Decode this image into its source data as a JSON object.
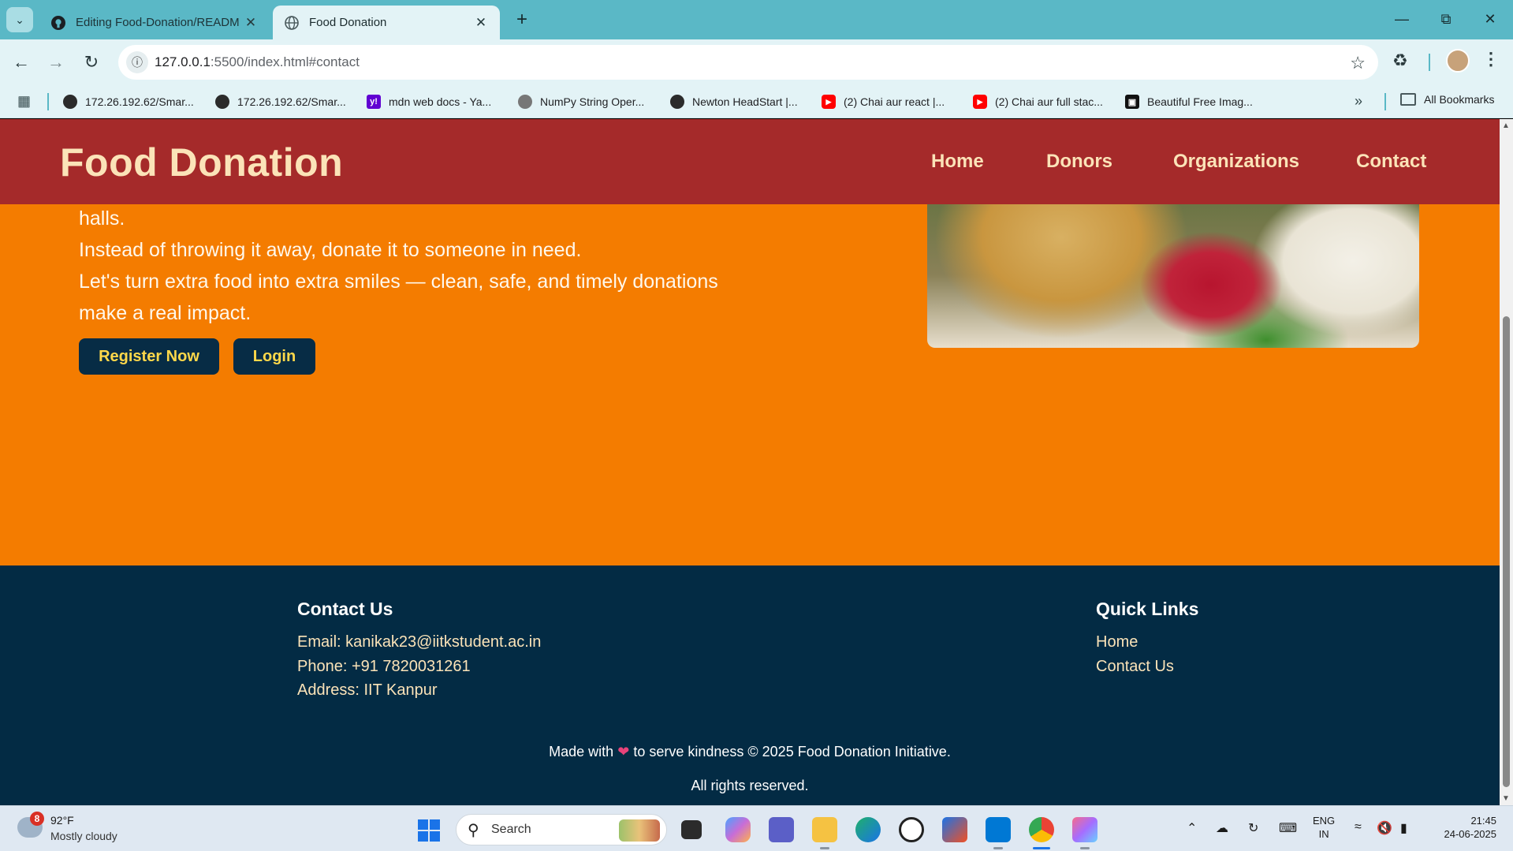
{
  "browser": {
    "tabs": [
      {
        "title": "Editing Food-Donation/READM",
        "icon": "github-icon",
        "active": false
      },
      {
        "title": "Food Donation",
        "icon": "globe-icon",
        "active": true
      }
    ],
    "new_tab_label": "+",
    "url_host": "127.0.0.1",
    "url_path": ":5500/index.html#contact",
    "bookmarks": [
      {
        "label": "172.26.192.62/Smar...",
        "icon": "globe-icon"
      },
      {
        "label": "172.26.192.62/Smar...",
        "icon": "globe-icon"
      },
      {
        "label": "mdn web docs - Ya...",
        "icon": "yahoo-icon"
      },
      {
        "label": "NumPy String Oper...",
        "icon": "numpy-icon"
      },
      {
        "label": "Newton HeadStart |...",
        "icon": "globe-icon"
      },
      {
        "label": "(2) Chai aur react |...",
        "icon": "youtube-icon"
      },
      {
        "label": "(2) Chai aur full stac...",
        "icon": "youtube-icon"
      },
      {
        "label": "Beautiful Free Imag...",
        "icon": "unsplash-icon"
      }
    ],
    "all_bookmarks_label": "All Bookmarks"
  },
  "site": {
    "brand": "Food Donation",
    "nav": [
      "Home",
      "Donors",
      "Organizations",
      "Contact"
    ],
    "hero_lines": [
      "halls.",
      "Instead of throwing it away, donate it to someone in need.",
      "Let's turn extra food into extra smiles — clean, safe, and timely donations make a real impact."
    ],
    "buttons": {
      "register": "Register Now",
      "login": "Login"
    },
    "colors": {
      "header": "#a52a2a",
      "hero": "#f47c00",
      "footer": "#032b44",
      "button": "#072c45",
      "button_text": "#ffd84a",
      "accent_text": "#fbe3b8"
    }
  },
  "footer": {
    "contact_heading": "Contact Us",
    "email": "Email: kanikak23@iitkstudent.ac.in",
    "phone": "Phone: +91 7820031261",
    "address": "Address: IIT Kanpur",
    "links_heading": "Quick Links",
    "links": [
      "Home",
      "Contact Us"
    ],
    "made_with_before": "Made with",
    "made_with_after": "to serve kindness © 2025 Food Donation Initiative.",
    "rights": "All rights reserved."
  },
  "taskbar": {
    "weather_badge": "8",
    "temperature": "92°F",
    "weather_desc": "Mostly cloudy",
    "search_label": "Search",
    "lang_line1": "ENG",
    "lang_line2": "IN",
    "time": "21:45",
    "date": "24-06-2025"
  }
}
